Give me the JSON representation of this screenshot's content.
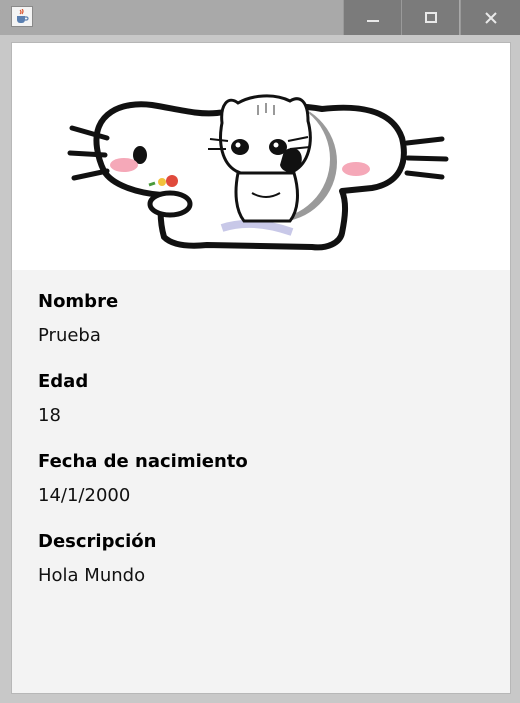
{
  "window": {
    "title": "",
    "controls": {
      "minimize_icon": "minimize-icon",
      "maximize_icon": "maximize-icon",
      "close_icon": "close-icon"
    },
    "app_icon": "java-cup-icon"
  },
  "profile": {
    "image_icon": "cartoon-cat-picture",
    "fields": [
      {
        "label": "Nombre",
        "value": "Prueba"
      },
      {
        "label": "Edad",
        "value": "18"
      },
      {
        "label": "Fecha de nacimiento",
        "value": "14/1/2000"
      },
      {
        "label": "Descripción",
        "value": "Hola Mundo"
      }
    ]
  },
  "colors": {
    "titlebar": "#a9a9a9",
    "window_buttons": "#7b7b7b",
    "panel_background": "#f3f3f3",
    "image_background": "#ffffff"
  }
}
